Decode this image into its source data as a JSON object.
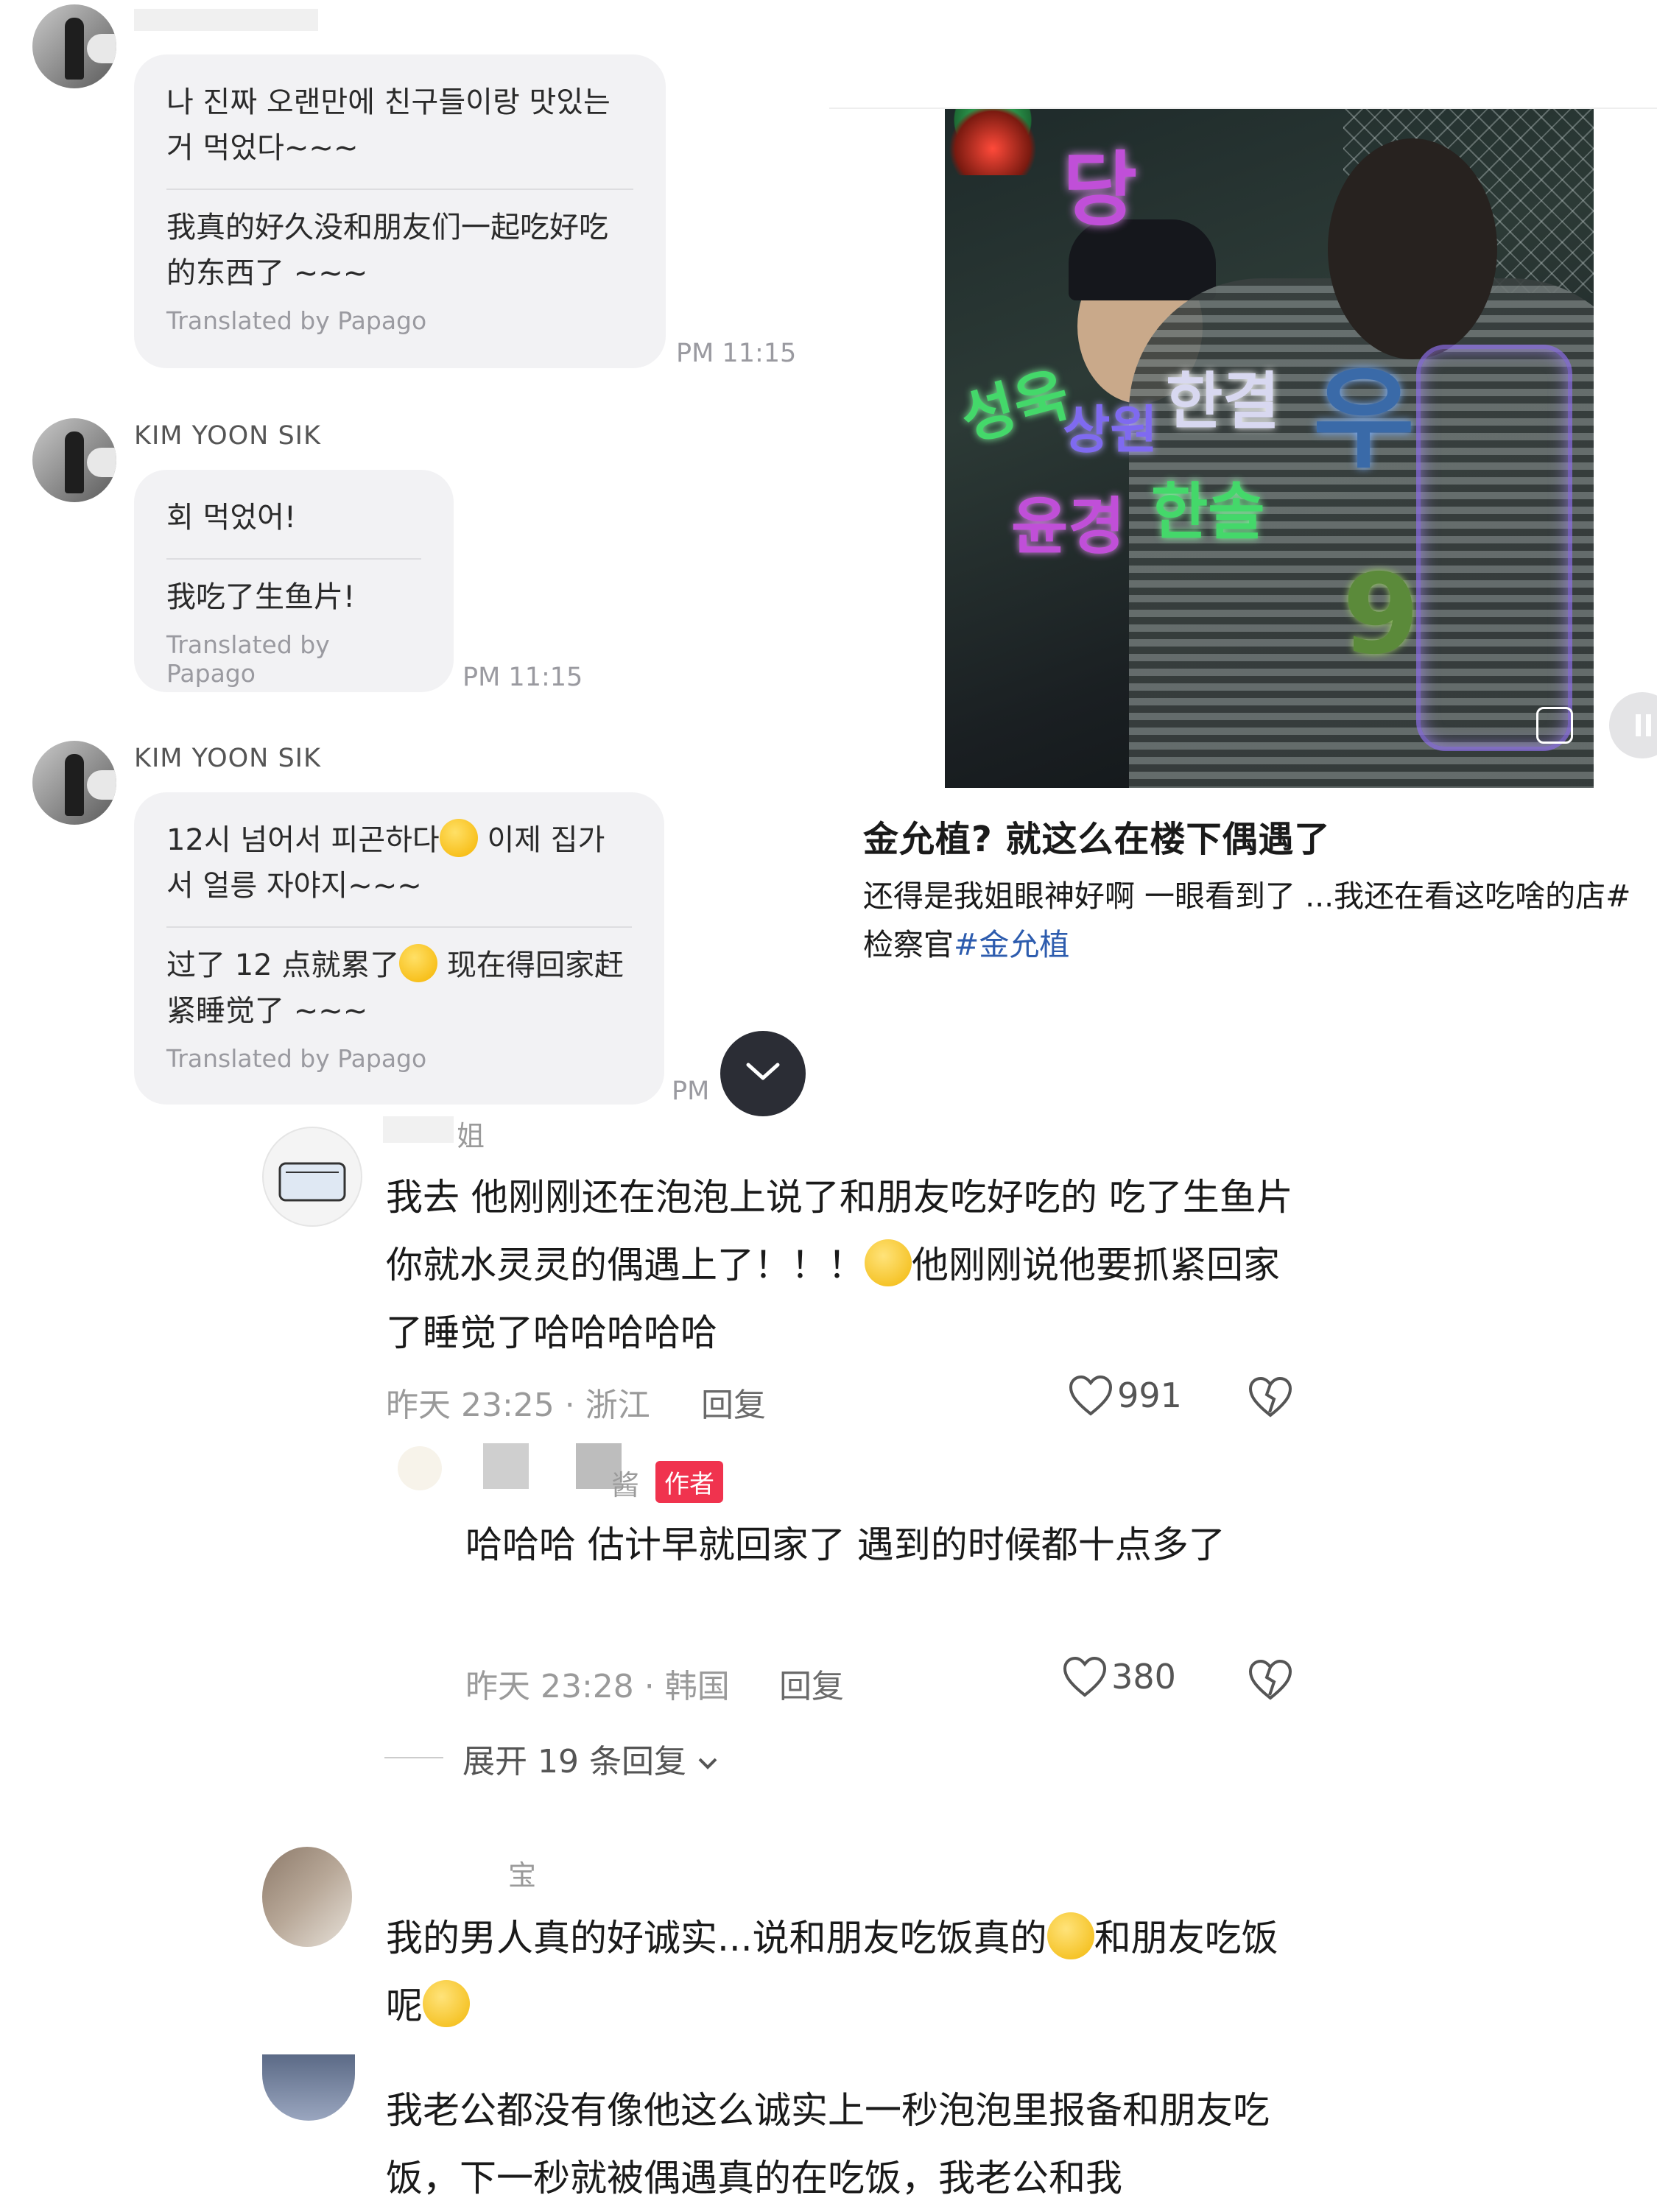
{
  "chat": {
    "messages": [
      {
        "sender": "",
        "original": "나 진짜 오랜만에 친구들이랑 맛있는 거 먹었다~~~",
        "translation": "我真的好久没和朋友们一起吃好吃的东西了 ~~~",
        "translated_by": "Translated by Papago",
        "time": "PM 11:15"
      },
      {
        "sender": "KIM YOON SIK",
        "original": "회 먹었어!",
        "translation": "我吃了生鱼片!",
        "translated_by": "Translated by Papago",
        "time": "PM 11:15"
      },
      {
        "sender": "KIM YOON SIK",
        "original_part1": "12시 넘어서 피곤하다",
        "original_part2": " 이제 집가서 얼릉 자야지~~~",
        "translation_part1": "过了 12 点就累了",
        "translation_part2": " 现在得回家赶紧睡觉了 ~~~",
        "translated_by": "Translated by Papago",
        "time": "PM"
      }
    ]
  },
  "post": {
    "photo_neon_text": [
      "당",
      "성욱",
      "상원",
      "한결",
      "윤경",
      "한솔",
      "9",
      "우"
    ],
    "title": "金允植? 就这么在楼下偶遇了",
    "body": "还得是我姐眼神好啊 一眼看到了 ...我还在看这吃啥的店#检察官",
    "hashtag": "#金允植"
  },
  "comments": [
    {
      "name": "姐",
      "text_part1": "我去 他刚刚还在泡泡上说了和朋友吃好吃的 吃了生鱼片 你就水灵灵的偶遇上了！！！",
      "text_part2": "他刚刚说他要抓紧回家了睡觉了哈哈哈哈哈",
      "time_loc": "昨天 23:25 · 浙江",
      "reply": "回复",
      "likes": "991"
    },
    {
      "name": "酱",
      "author_tag": "作者",
      "text": "哈哈哈 估计早就回家了 遇到的时候都十点多了",
      "time_loc": "昨天 23:28 · 韩国",
      "reply": "回复",
      "likes": "380"
    },
    {
      "expand": "展开 19 条回复"
    },
    {
      "name": "宝",
      "text_part1": "我的男人真的好诚实...说和朋友吃饭真的",
      "text_part2": "和朋友吃饭呢"
    },
    {
      "name": "",
      "text": "我老公都没有像他这么诚实上一秒泡泡里报备和朋友吃饭，下一秒就被偶遇真的在吃饭，我老公和我"
    }
  ],
  "icons": {
    "heart": "heart-icon",
    "dislike": "broken-heart-icon",
    "chevron": "chevron-down-icon",
    "pause": "pause-icon",
    "lens": "image-search-icon"
  },
  "colors": {
    "author_tag": "#f0334e",
    "hashtag": "#2d5cae",
    "bubble": "#f2f2f4",
    "scroll_button": "#2b2d35"
  }
}
